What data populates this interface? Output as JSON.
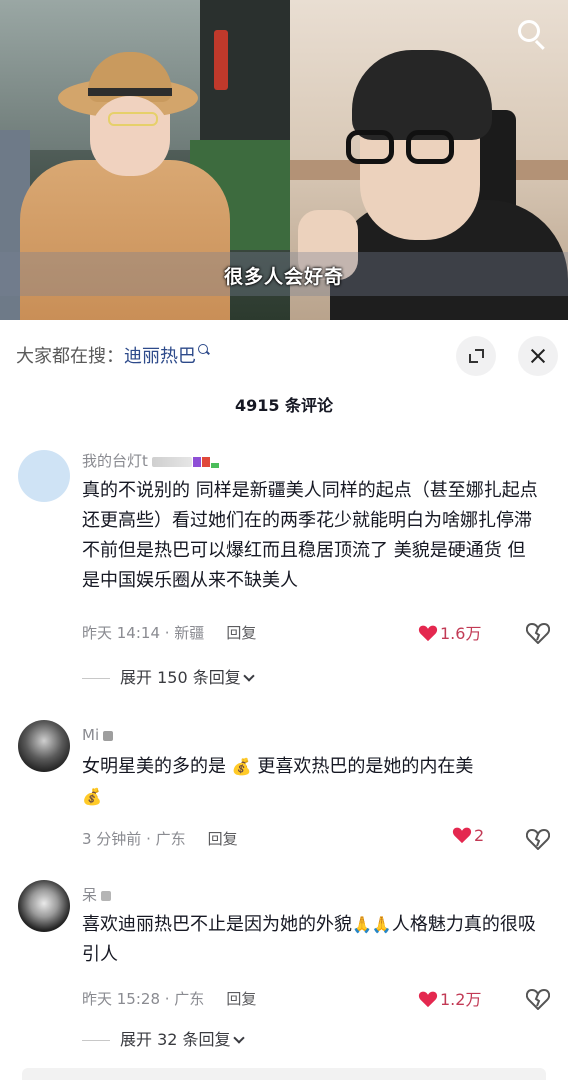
{
  "video": {
    "subtitle": "很多人会好奇"
  },
  "sheet": {
    "hot_search_prefix": "大家都在搜：",
    "hot_search_keyword": "迪丽热巴",
    "comment_count_label": "4915 条评论"
  },
  "comments": [
    {
      "username": "我的台灯t",
      "text": "真的不说别的 同样是新疆美人同样的起点（甚至娜扎起点还更高些）看过她们在的两季花少就能明白为啥娜扎停滞不前但是热巴可以爆红而且稳居顶流了 美貌是硬通货 但是中国娱乐圈从来不缺美人",
      "time_location": "昨天 14:14 · 新疆",
      "reply_label": "回复",
      "likes": "1.6万",
      "liked": true,
      "expand_label": "展开 150 条回复"
    },
    {
      "username": "Mi",
      "text_a": "女明星美的多的是",
      "text_b": "更喜欢热巴的是她的内在美",
      "emoji": "💰",
      "time_location": "3 分钟前 · 广东",
      "reply_label": "回复",
      "likes": "2",
      "liked": true
    },
    {
      "username": "呆",
      "text_a": "喜欢迪丽热巴不止是因为她的外貌",
      "text_b": "人格魅力真的很吸引人",
      "emoji": "🙏",
      "time_location": "昨天 15:28 · 广东",
      "reply_label": "回复",
      "likes": "1.2万",
      "liked": true,
      "expand_label": "展开 32 条回复"
    }
  ],
  "colors": {
    "like_red": "#e4284f",
    "keyword_blue": "#2d4a8a",
    "meta_gray": "#8a8b91"
  },
  "icons": [
    "search-icon",
    "expand-icon",
    "close-icon",
    "heart-icon",
    "broken-heart-icon",
    "chevron-down-icon"
  ]
}
